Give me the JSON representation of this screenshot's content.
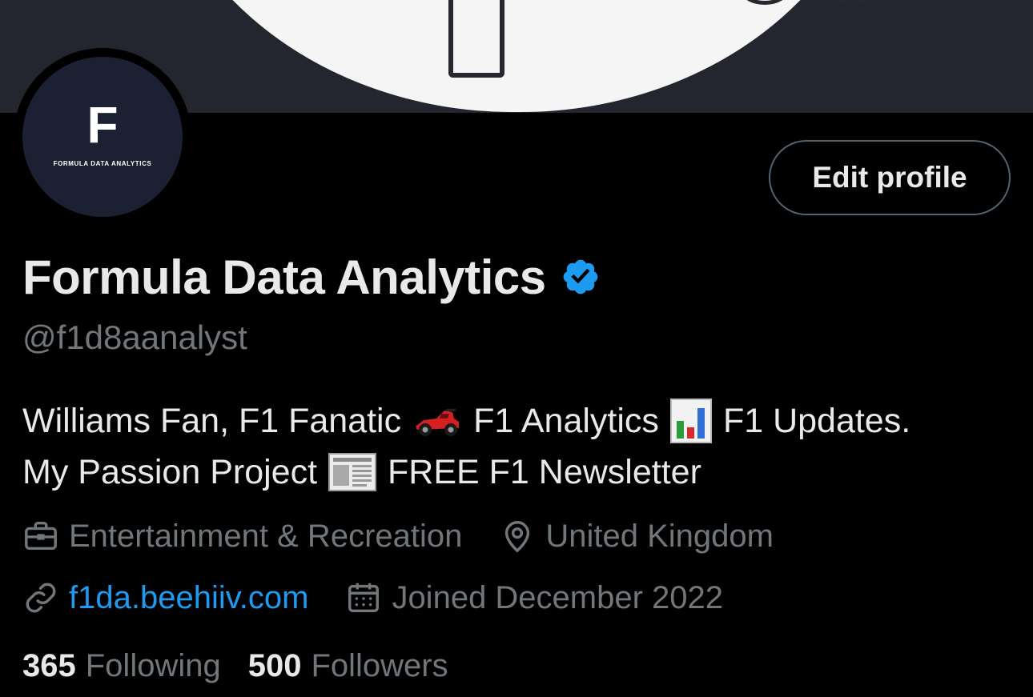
{
  "profile": {
    "avatar_letter": "F",
    "avatar_tagline": "FORMULA DATA ANALYTICS",
    "edit_button": "Edit profile",
    "display_name": "Formula Data Analytics",
    "verified": true,
    "handle": "@f1d8aanalyst",
    "bio": {
      "line1_part1": "Williams Fan, F1 Fanatic",
      "line1_part2": "F1 Analytics",
      "line1_part3": "F1 Updates.",
      "line2_part1": "My Passion Project",
      "line2_part2": "FREE F1 Newsletter",
      "emojis": [
        "race-car-icon",
        "bar-chart-icon",
        "newspaper-icon"
      ]
    },
    "meta": {
      "category": "Entertainment & Recreation",
      "location": "United Kingdom",
      "website": "f1da.beehiiv.com",
      "joined": "Joined December 2022"
    },
    "stats": {
      "following_count": "365",
      "following_label": "Following",
      "followers_count": "500",
      "followers_label": "Followers"
    }
  },
  "colors": {
    "background": "#000000",
    "text_primary": "#e7e9ea",
    "text_secondary": "#71767b",
    "link": "#1d9bf0",
    "verified_badge": "#1d9bf0",
    "avatar_bg": "#1c2033",
    "banner_bg": "#23262e"
  }
}
